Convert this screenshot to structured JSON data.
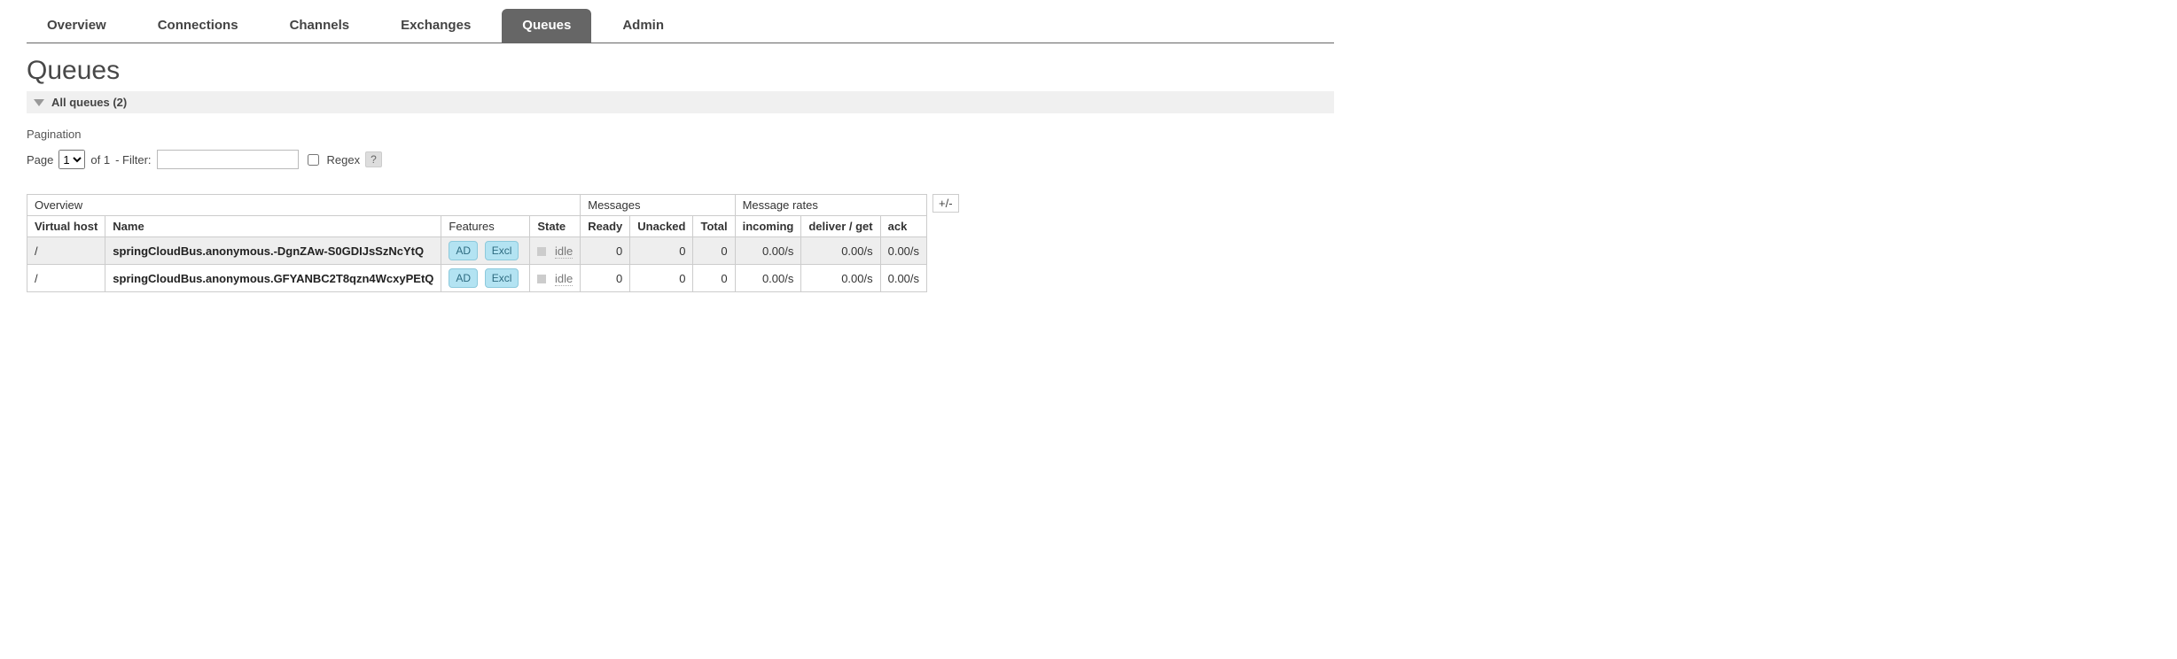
{
  "tabs": [
    "Overview",
    "Connections",
    "Channels",
    "Exchanges",
    "Queues",
    "Admin"
  ],
  "active_tab": "Queues",
  "page_title": "Queues",
  "section_header": "All queues (2)",
  "pagination": {
    "label": "Pagination",
    "page_label": "Page",
    "page_value": "1",
    "of_label": "of 1",
    "filter_label": "-  Filter:",
    "filter_value": "",
    "regex_label": "Regex",
    "help": "?"
  },
  "table": {
    "group_headers": [
      "Overview",
      "Messages",
      "Message rates"
    ],
    "plusminus": "+/-",
    "columns": {
      "vhost": "Virtual host",
      "name": "Name",
      "features": "Features",
      "state": "State",
      "ready": "Ready",
      "unacked": "Unacked",
      "total": "Total",
      "incoming": "incoming",
      "deliver_get": "deliver / get",
      "ack": "ack"
    },
    "feature_badges": {
      "ad": "AD",
      "excl": "Excl"
    },
    "rows": [
      {
        "vhost": "/",
        "name": "springCloudBus.anonymous.-DgnZAw-S0GDIJsSzNcYtQ",
        "state": "idle",
        "ready": "0",
        "unacked": "0",
        "total": "0",
        "incoming": "0.00/s",
        "deliver_get": "0.00/s",
        "ack": "0.00/s"
      },
      {
        "vhost": "/",
        "name": "springCloudBus.anonymous.GFYANBC2T8qzn4WcxyPEtQ",
        "state": "idle",
        "ready": "0",
        "unacked": "0",
        "total": "0",
        "incoming": "0.00/s",
        "deliver_get": "0.00/s",
        "ack": "0.00/s"
      }
    ]
  }
}
